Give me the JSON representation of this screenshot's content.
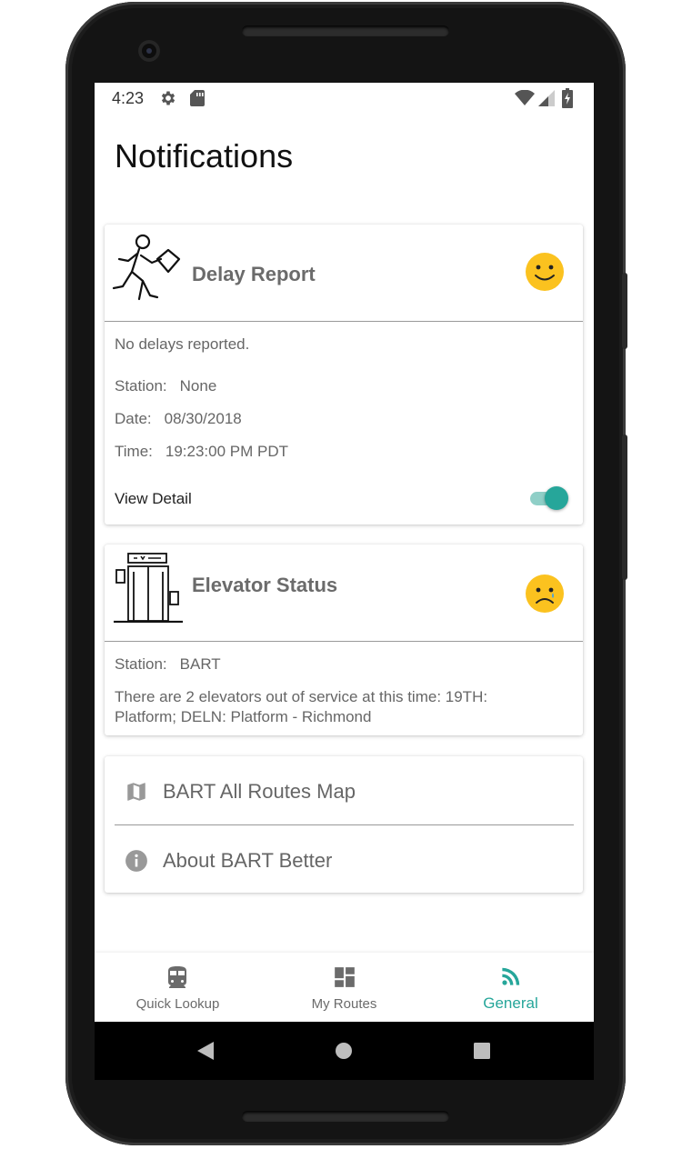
{
  "status_bar": {
    "time": "4:23",
    "left_icons": [
      "gear-icon",
      "sd-card-icon"
    ],
    "right_icons": [
      "wifi-icon",
      "signal-icon",
      "battery-charging-icon"
    ]
  },
  "page": {
    "title": "Notifications"
  },
  "delay_card": {
    "title": "Delay Report",
    "icon": "running-person-icon",
    "mood": "happy",
    "message": "No delays reported.",
    "station_label": "Station:",
    "station_value": "None",
    "date_label": "Date:",
    "date_value": "08/30/2018",
    "time_label": "Time:",
    "time_value": "19:23:00 PM PDT",
    "view_detail_label": "View Detail",
    "view_detail_on": true
  },
  "elevator_card": {
    "title": "Elevator Status",
    "icon": "elevator-icon",
    "mood": "sad",
    "station_label": "Station:",
    "station_value": "BART",
    "message_line1": "There are 2 elevators out of service at this time: 19TH:",
    "message_line2": "Platform; DELN: Platform - Richmond"
  },
  "links": [
    {
      "label": "BART All Routes Map",
      "icon": "map-icon"
    },
    {
      "label": "About BART Better",
      "icon": "info-icon"
    }
  ],
  "bottom_nav": [
    {
      "label": "Quick Lookup",
      "icon": "train-icon",
      "active": false
    },
    {
      "label": "My Routes",
      "icon": "dashboard-icon",
      "active": false
    },
    {
      "label": "General",
      "icon": "rss-feed-icon",
      "active": true
    }
  ],
  "colors": {
    "accent": "#26a69a",
    "accent_light": "#8fcfc7",
    "emoji_yellow": "#fbc21f",
    "text_grey": "#666666",
    "title_grey": "#6b6b6b"
  }
}
